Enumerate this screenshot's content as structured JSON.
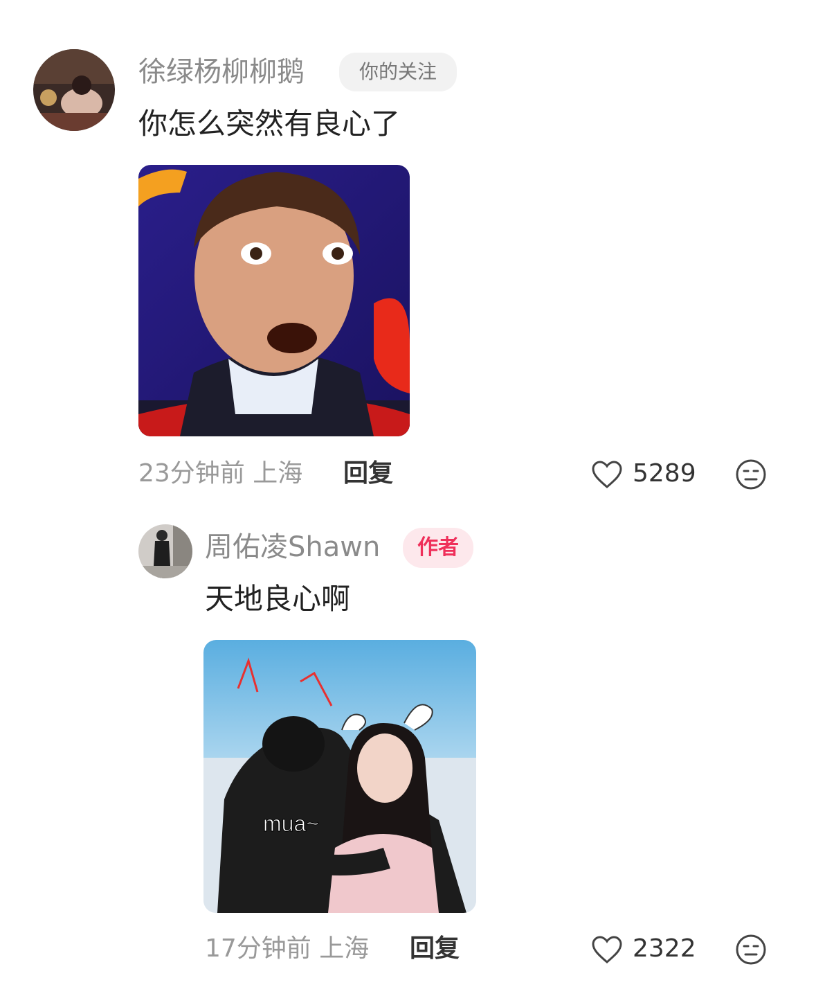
{
  "comment1": {
    "user_name": "徐绿杨柳柳鹅",
    "follow_tag": "你的关注",
    "text": "你怎么突然有良心了",
    "time": "23分钟前",
    "location": "上海",
    "reply_label": "回复",
    "likes": "5289",
    "image_desc_icon": "meme-image"
  },
  "comment2": {
    "user_name": "周佑凌Shawn",
    "author_tag": "作者",
    "text": "天地良心啊",
    "image_caption": "mua~",
    "time": "17分钟前",
    "location": "上海",
    "reply_label": "回复",
    "likes": "2322"
  },
  "icons": {
    "like": "heart-icon",
    "emoji": "neutral-face-icon"
  },
  "colors": {
    "author_tag_text": "#ef2f5a",
    "author_tag_bg": "#fde8ec",
    "follow_tag_bg": "#f2f2f2",
    "meta_text": "#999999"
  }
}
